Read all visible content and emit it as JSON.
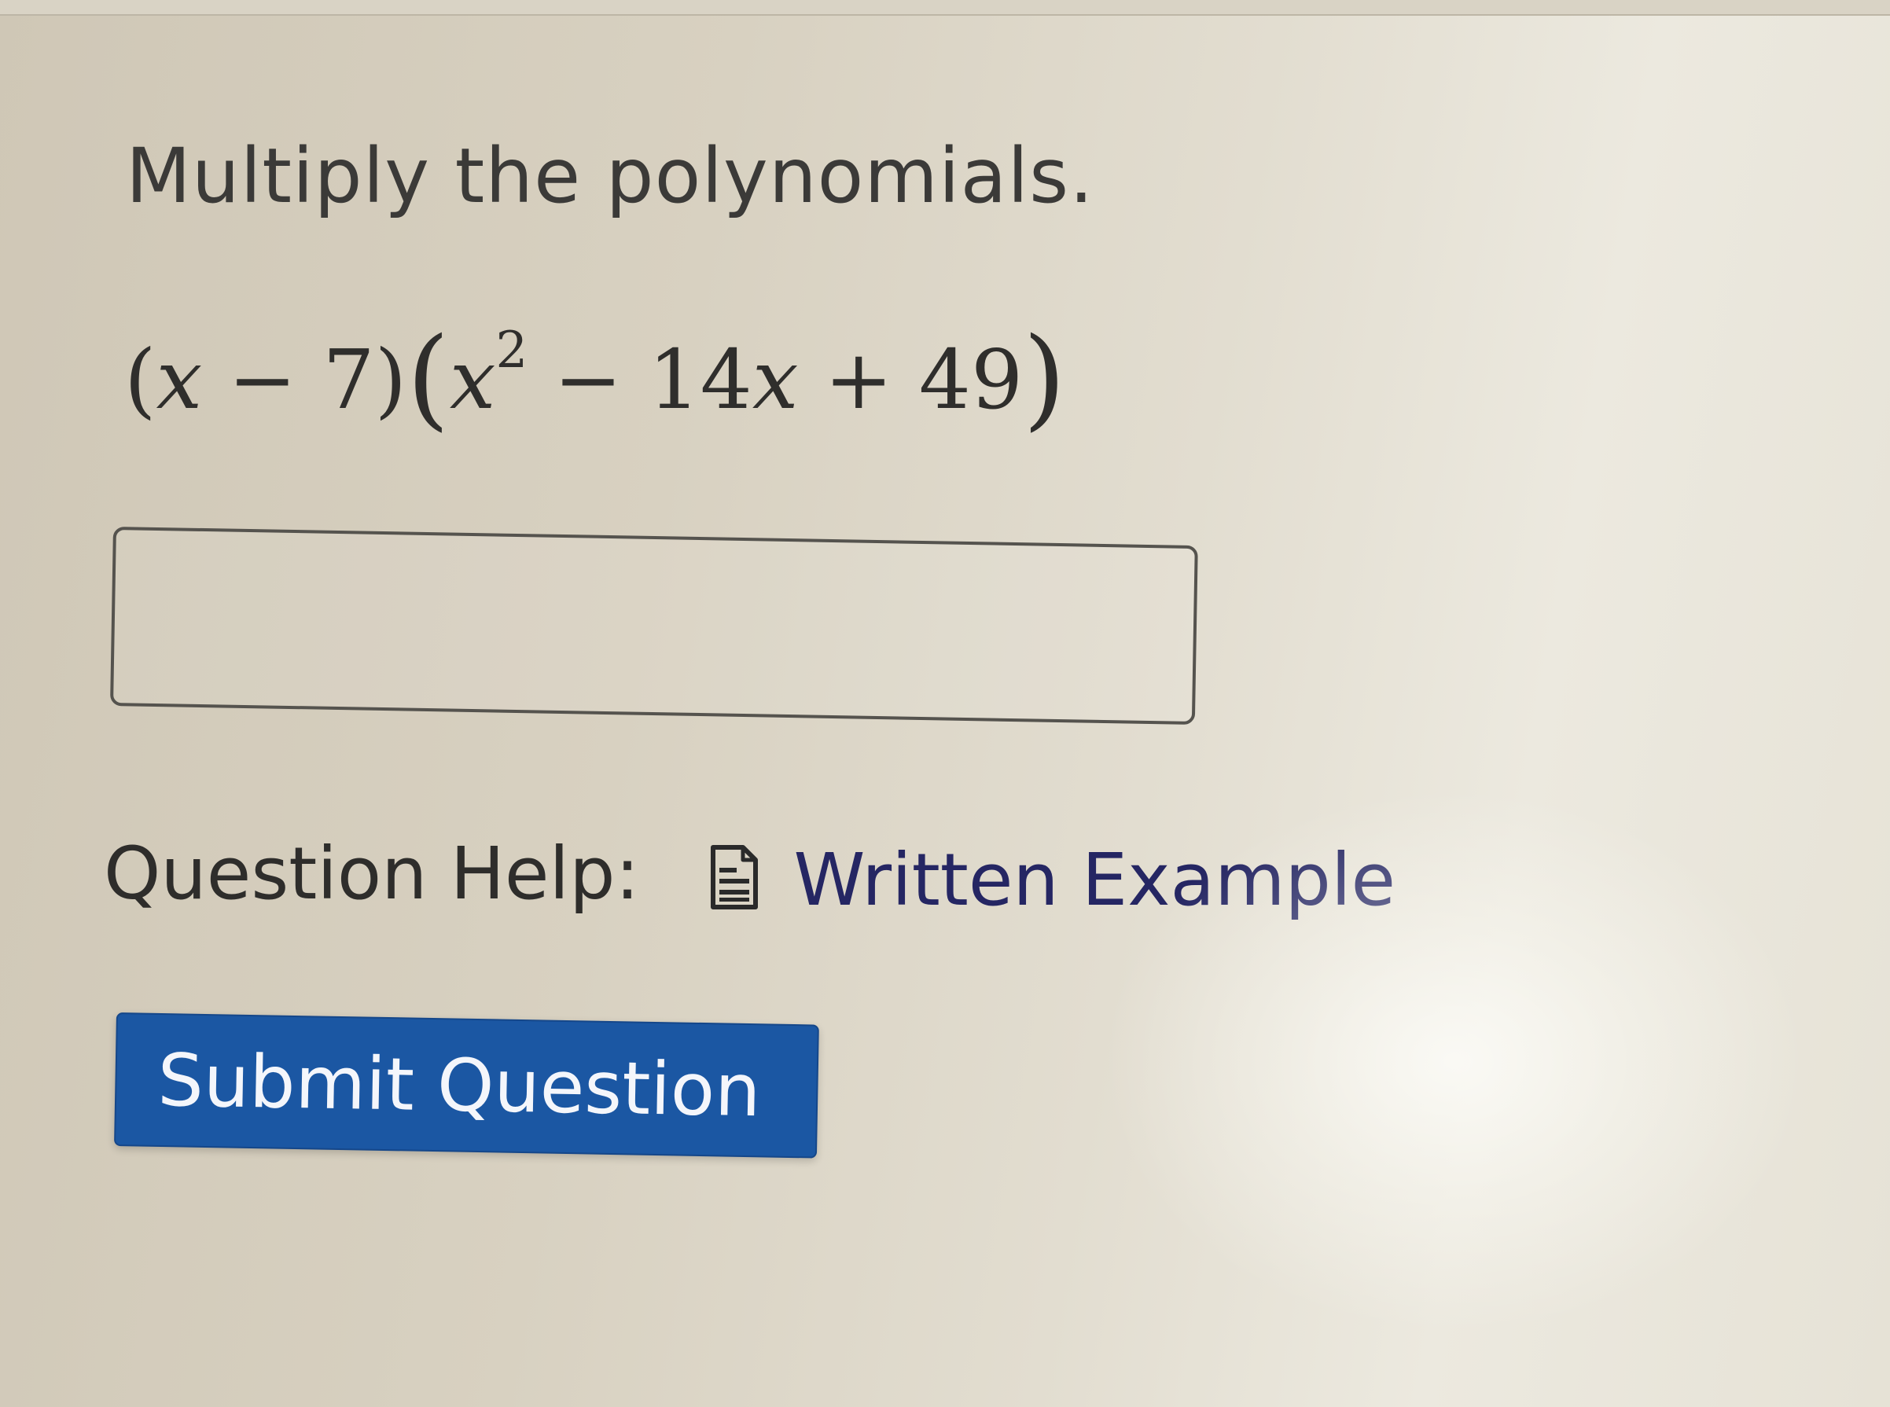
{
  "question": {
    "prompt": "Multiply the polynomials.",
    "expression": {
      "factor1": {
        "open": "(",
        "var": "x",
        "op": "−",
        "const": "7",
        "close": ")"
      },
      "factor2": {
        "open": "(",
        "var1": "x",
        "exponent": "2",
        "op1": "−",
        "coef": "14",
        "var2": "x",
        "op2": "+",
        "const": "49",
        "close": ")"
      }
    }
  },
  "answer": {
    "value": "",
    "placeholder": ""
  },
  "help": {
    "label": "Question Help:",
    "icon": "document-icon",
    "link_text": "Written Example"
  },
  "actions": {
    "submit_label": "Submit Question"
  },
  "colors": {
    "submit_bg": "#1b57a3",
    "link": "#252663",
    "text": "#3b3a38"
  }
}
